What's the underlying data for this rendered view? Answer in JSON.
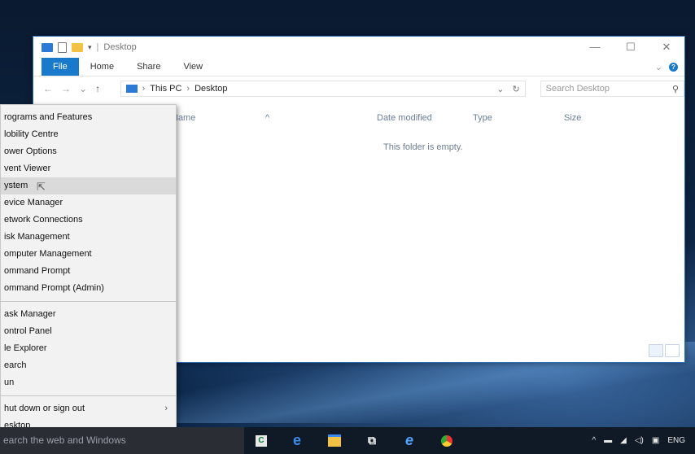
{
  "explorer": {
    "title": "Desktop",
    "qat_separator": "|",
    "ribbon_tabs": [
      "File",
      "Home",
      "Share",
      "View"
    ],
    "ribbon_expand": "⌄",
    "help": "?",
    "nav": {
      "back": "←",
      "forward": "→",
      "recent": "⌄",
      "up": "↑"
    },
    "breadcrumb": [
      "This PC",
      "Desktop"
    ],
    "breadcrumb_sep": "›",
    "addr_dropdown": "⌄",
    "refresh": "↻",
    "search_placeholder": "Search Desktop",
    "search_icon": "⚲",
    "columns": [
      "Name",
      "Date modified",
      "Type",
      "Size"
    ],
    "sort_arrow": "^",
    "empty_text": "This folder is empty.",
    "window_controls": {
      "minimize": "—",
      "maximize": "☐",
      "close": "✕"
    }
  },
  "menu": {
    "group1": [
      "rograms and Features",
      "lobility Centre",
      "ower Options",
      "vent Viewer",
      "ystem",
      "evice Manager",
      "etwork Connections",
      "isk Management",
      "omputer Management",
      "ommand Prompt",
      "ommand Prompt (Admin)"
    ],
    "highlighted_index": 4,
    "group2": [
      "ask Manager",
      "ontrol Panel",
      "le Explorer",
      "earch",
      "un"
    ],
    "group3": [
      "hut down or sign out",
      "esktop"
    ],
    "submenu_arrow": "›"
  },
  "taskbar": {
    "search_text": "earch the web and Windows",
    "apps": [
      "store-app-icon",
      "edge-icon",
      "file-explorer-icon",
      "store-bag-icon",
      "internet-explorer-icon",
      "chrome-icon"
    ],
    "tray_lang": "ENG",
    "tray_caret": "^"
  },
  "colors": {
    "accent": "#1979ca",
    "taskbar": "#101a26",
    "menu_bg": "#f2f2f2",
    "highlight": "#dadada"
  }
}
